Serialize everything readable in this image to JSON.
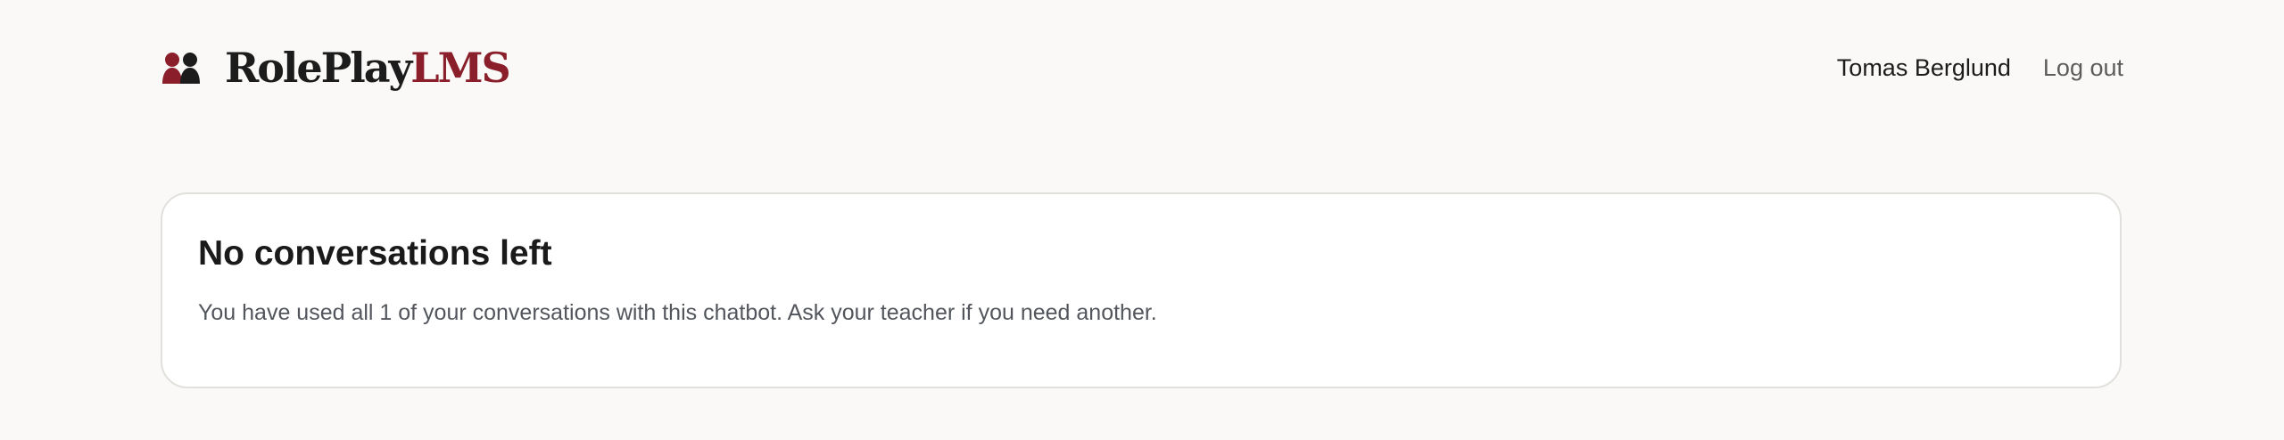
{
  "header": {
    "brand": {
      "word_primary": "RolePlay",
      "word_accent": "LMS",
      "icon": "two-people-silhouette-icon"
    },
    "user_name": "Tomas Berglund",
    "logout_label": "Log out"
  },
  "notice": {
    "title": "No conversations left",
    "message": "You have used all 1 of your conversations with this chatbot. Ask your teacher if you need another."
  },
  "colors": {
    "brand_accent": "#8a1f2b",
    "brand_dark": "#1c1c1c",
    "background": "#faf9f7",
    "card_background": "#ffffff",
    "muted_text": "#52565c"
  }
}
